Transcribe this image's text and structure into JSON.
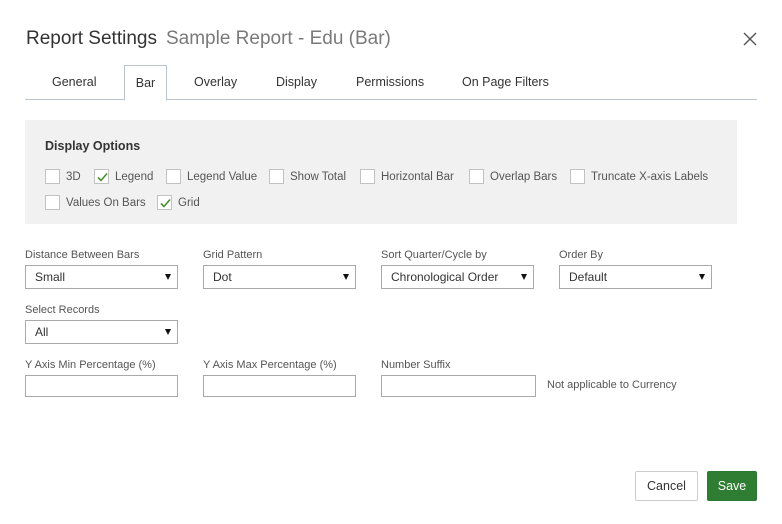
{
  "header": {
    "title": "Report Settings",
    "subtitle": "Sample Report - Edu (Bar)"
  },
  "tabs": [
    {
      "label": "General",
      "active": false
    },
    {
      "label": "Bar",
      "active": true
    },
    {
      "label": "Overlay",
      "active": false
    },
    {
      "label": "Display",
      "active": false
    },
    {
      "label": "Permissions",
      "active": false
    },
    {
      "label": "On Page Filters",
      "active": false
    }
  ],
  "display_options": {
    "title": "Display Options",
    "items": [
      {
        "label": "3D",
        "checked": false
      },
      {
        "label": "Legend",
        "checked": true
      },
      {
        "label": "Legend Value",
        "checked": false
      },
      {
        "label": "Show Total",
        "checked": false
      },
      {
        "label": "Horizontal Bar",
        "checked": false
      },
      {
        "label": "Overlap Bars",
        "checked": false
      },
      {
        "label": "Truncate X-axis Labels",
        "checked": false
      },
      {
        "label": "Values On Bars",
        "checked": false
      },
      {
        "label": "Grid",
        "checked": true
      }
    ]
  },
  "fields": {
    "distance_between_bars": {
      "label": "Distance Between Bars",
      "value": "Small"
    },
    "grid_pattern": {
      "label": "Grid Pattern",
      "value": "Dot"
    },
    "sort_quarter": {
      "label": "Sort Quarter/Cycle by",
      "value": "Chronological Order"
    },
    "order_by": {
      "label": "Order By",
      "value": "Default"
    },
    "select_records": {
      "label": "Select Records",
      "value": "All"
    },
    "y_axis_min": {
      "label": "Y Axis Min Percentage (%)",
      "value": ""
    },
    "y_axis_max": {
      "label": "Y Axis Max Percentage (%)",
      "value": ""
    },
    "number_suffix": {
      "label": "Number Suffix",
      "value": "",
      "note": "Not applicable to Currency"
    }
  },
  "footer": {
    "cancel_label": "Cancel",
    "save_label": "Save"
  },
  "colors": {
    "save_bg": "#2e7d32",
    "check": "#4a8f2e"
  }
}
